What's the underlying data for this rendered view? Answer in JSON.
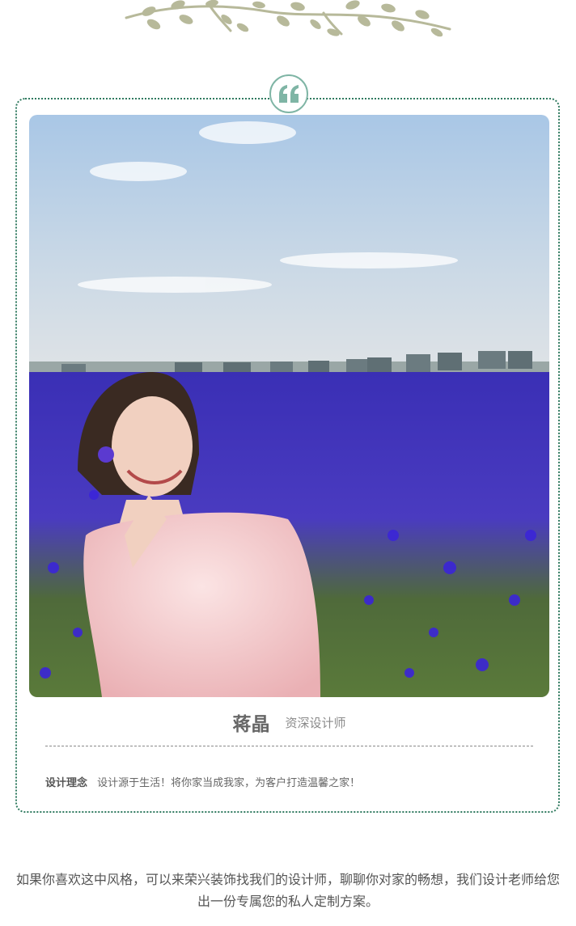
{
  "designer": {
    "name": "蒋晶",
    "title": "资深设计师",
    "concept_label": "设计理念",
    "concept_text": "设计源于生活！将你家当成我家，为客户打造温馨之家！"
  },
  "footer": {
    "text": "如果你喜欢这中风格，可以来荣兴装饰找我们的设计师，聊聊你对家的畅想，我们设计老师给您出一份专属您的私人定制方案。"
  },
  "icons": {
    "top_decoration": "vine-decoration-icon",
    "badge": "quote-icon"
  },
  "colors": {
    "accent": "#2f7a5f",
    "badge_mark": "#7fb5a5",
    "vine": "#b7b99a"
  }
}
